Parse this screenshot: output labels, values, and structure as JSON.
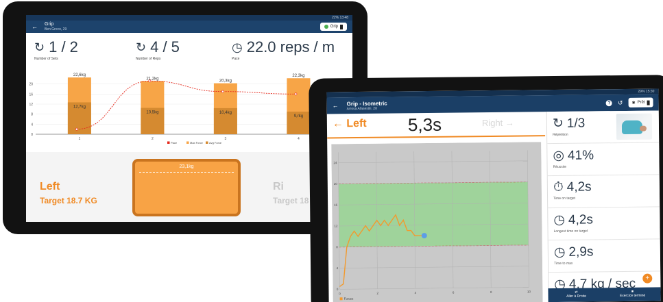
{
  "tablet1": {
    "status": "22% 13:48",
    "title": "Grip",
    "subtitle": "Ben Greco, 29",
    "device_chip": "Grip",
    "stats": [
      {
        "value": "1 / 2",
        "label": "Number of Sets"
      },
      {
        "value": "4 / 5",
        "label": "Number of Reps"
      },
      {
        "value": "22.0 reps / m",
        "label": "Pace"
      }
    ],
    "left_side": {
      "name": "Left",
      "target": "Target 18.7 KG"
    },
    "right_side": {
      "name": "Ri",
      "target": "Target 18"
    },
    "gauge_value": "23,1kg",
    "chart_data": {
      "type": "bar",
      "categories": [
        "1",
        "2",
        "3",
        "4"
      ],
      "series": [
        {
          "name": "Max Force",
          "values": [
            22.6,
            21.2,
            20.3,
            22.3
          ]
        },
        {
          "name": "Avg Force",
          "values": [
            12.7,
            10.5,
            10.4,
            9.0
          ]
        },
        {
          "name": "Pace",
          "values": [
            2,
            21.2,
            17,
            16
          ]
        }
      ],
      "bar_labels_max": [
        "22,6kg",
        "21,2kg",
        "20,3kg",
        "22,3kg"
      ],
      "bar_labels_avg": [
        "12,7kg",
        "10,5kg",
        "10,4kg",
        "9,rkg"
      ],
      "yticks": [
        "0",
        "4",
        "8",
        "12",
        "16",
        "20"
      ],
      "ylim": [
        0,
        24
      ],
      "legend": [
        "Pace",
        "Max Force",
        "Avg Force"
      ],
      "colors": {
        "max": "#f7a547",
        "avg": "#d58a30",
        "pace": "#e5281b"
      }
    }
  },
  "tablet2": {
    "status": "29% 15:30",
    "title": "Grip - Isometric",
    "subtitle": "Arrosa Afasestili, 28",
    "chip": "Prêt",
    "left": "← Left",
    "time": "5,3s",
    "right": "Right →",
    "stats": [
      {
        "value": "1/3",
        "label": "Répétition"
      },
      {
        "value": "41%",
        "label": "Réussite"
      },
      {
        "value": "4,2s",
        "label": "Time on target"
      },
      {
        "value": "4,2s",
        "label": "Longest time on target"
      },
      {
        "value": "2,9s",
        "label": "Time to max"
      },
      {
        "value": "4,7 kg / sec",
        "label": ""
      }
    ],
    "bottom": [
      "Aller à Droite",
      "Exercice terminé"
    ],
    "fab": "+",
    "chart_data": {
      "type": "line",
      "series": [
        {
          "name": "Forces",
          "x": [
            0,
            0.2,
            0.4,
            0.6,
            0.8,
            1.0,
            1.2,
            1.4,
            1.6,
            1.8,
            2.0,
            2.2,
            2.4,
            2.6,
            2.8,
            3.0,
            3.2,
            3.4,
            3.6,
            3.8,
            4.0,
            4.2,
            4.5
          ],
          "y": [
            0.5,
            1,
            8,
            10,
            11,
            10,
            11,
            12,
            11,
            12,
            13,
            12,
            13,
            12,
            13,
            14,
            12,
            13,
            11,
            11,
            10,
            10,
            10
          ]
        }
      ],
      "band": [
        8,
        20
      ],
      "xticks": [
        "0",
        "2",
        "4",
        "6",
        "8",
        "10"
      ],
      "yticks": [
        "0",
        "4",
        "8",
        "12",
        "16",
        "20",
        "24"
      ],
      "xlim": [
        0,
        10
      ],
      "ylim": [
        0,
        26
      ],
      "legend": "Forces",
      "colors": {
        "line": "#f29a2e",
        "band": "#9fd39b",
        "bg": "#c9c9c9",
        "limit": "#d9423a",
        "dot": "#5d9de6"
      }
    }
  }
}
